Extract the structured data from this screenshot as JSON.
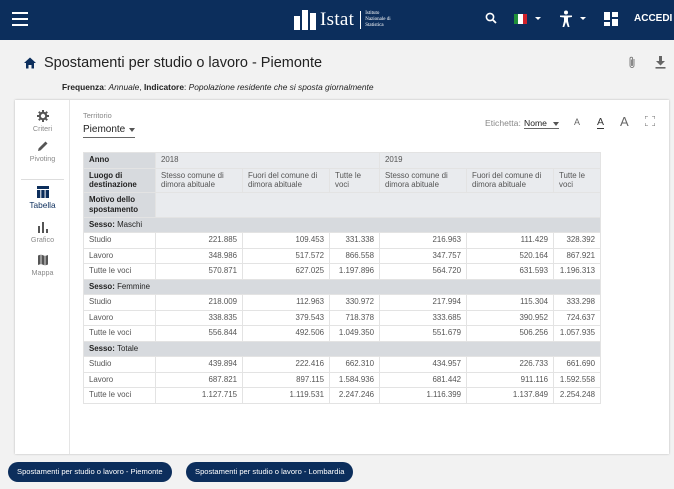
{
  "app": {
    "brand": "Istat",
    "brand_sub": "Istituto Nazionale di Statistica",
    "login_label": "ACCEDI",
    "accent_color": "#0c2e5c"
  },
  "page": {
    "title": "Spostamenti per studio o lavoro - Piemonte",
    "frequency_label": "Frequenza",
    "frequency_value": "Annuale",
    "indicator_label": "Indicatore",
    "indicator_value": "Popolazione residente che si sposta giornalmente"
  },
  "sidebar": {
    "items": [
      {
        "label": "Criteri",
        "icon": "gear-icon"
      },
      {
        "label": "Pivoting",
        "icon": "pencil-icon"
      },
      {
        "label": "Tabella",
        "icon": "table-icon",
        "active": true
      },
      {
        "label": "Grafico",
        "icon": "bar-chart-icon"
      },
      {
        "label": "Mappa",
        "icon": "map-icon"
      }
    ]
  },
  "filters": {
    "territorio_label": "Territorio",
    "territorio_value": "Piemonte",
    "etichetta_label": "Etichetta:",
    "etichetta_value": "Nome",
    "font_sizes": [
      "A",
      "A",
      "A"
    ]
  },
  "table": {
    "year_label": "Anno",
    "dest_label": "Luogo di destinazione",
    "motive_label": "Motivo dello spostamento",
    "years": [
      "2018",
      "2019"
    ],
    "columns": [
      "Stesso comune di dimora abituale",
      "Fuori del comune di dimora abituale",
      "Tutte le voci"
    ],
    "sex_label": "Sesso:",
    "groups": [
      {
        "name": "Maschi",
        "rows": [
          {
            "label": "Studio",
            "values": [
              "221.885",
              "109.453",
              "331.338",
              "216.963",
              "111.429",
              "328.392"
            ]
          },
          {
            "label": "Lavoro",
            "values": [
              "348.986",
              "517.572",
              "866.558",
              "347.757",
              "520.164",
              "867.921"
            ]
          },
          {
            "label": "Tutte le voci",
            "values": [
              "570.871",
              "627.025",
              "1.197.896",
              "564.720",
              "631.593",
              "1.196.313"
            ]
          }
        ]
      },
      {
        "name": "Femmine",
        "rows": [
          {
            "label": "Studio",
            "values": [
              "218.009",
              "112.963",
              "330.972",
              "217.994",
              "115.304",
              "333.298"
            ]
          },
          {
            "label": "Lavoro",
            "values": [
              "338.835",
              "379.543",
              "718.378",
              "333.685",
              "390.952",
              "724.637"
            ]
          },
          {
            "label": "Tutte le voci",
            "values": [
              "556.844",
              "492.506",
              "1.049.350",
              "551.679",
              "506.256",
              "1.057.935"
            ]
          }
        ]
      },
      {
        "name": "Totale",
        "rows": [
          {
            "label": "Studio",
            "values": [
              "439.894",
              "222.416",
              "662.310",
              "434.957",
              "226.733",
              "661.690"
            ]
          },
          {
            "label": "Lavoro",
            "values": [
              "687.821",
              "897.115",
              "1.584.936",
              "681.442",
              "911.116",
              "1.592.558"
            ]
          },
          {
            "label": "Tutte le voci",
            "values": [
              "1.127.715",
              "1.119.531",
              "2.247.246",
              "1.116.399",
              "1.137.849",
              "2.254.248"
            ]
          }
        ]
      }
    ]
  },
  "tabs": [
    {
      "label": "Spostamenti per studio o lavoro - Piemonte"
    },
    {
      "label": "Spostamenti per studio o lavoro - Lombardia"
    }
  ]
}
